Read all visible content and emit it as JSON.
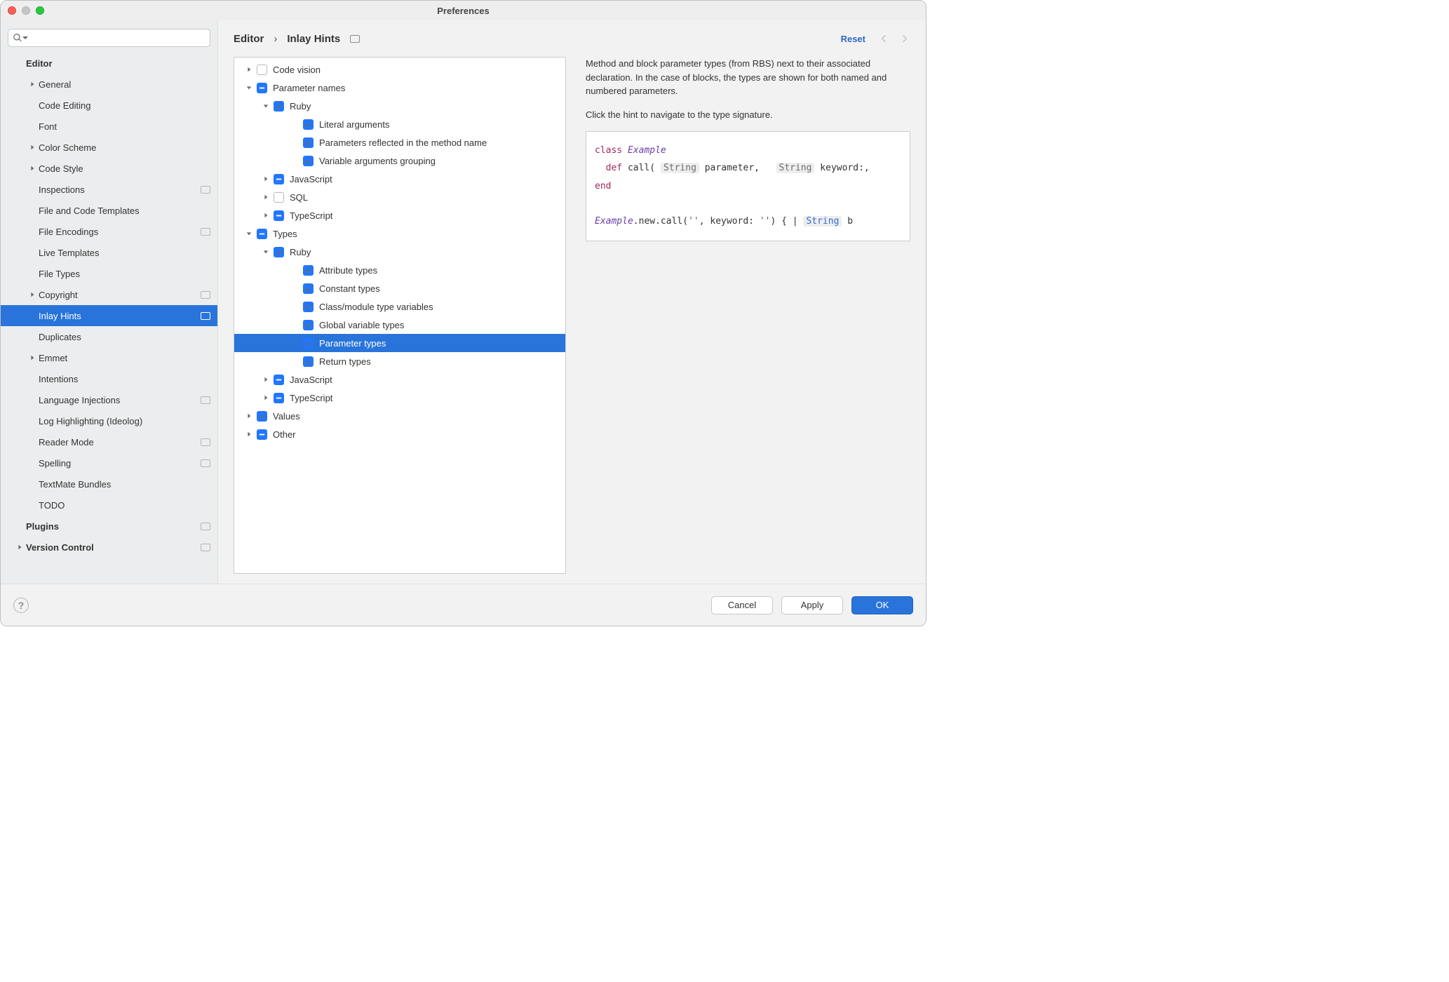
{
  "window_title": "Preferences",
  "search_placeholder": "",
  "sidebar": [
    {
      "label": "Editor",
      "header": true,
      "indent": 0,
      "chev": "",
      "badge": false
    },
    {
      "label": "General",
      "indent": 1,
      "chev": "right",
      "badge": false
    },
    {
      "label": "Code Editing",
      "indent": 1,
      "chev": "",
      "badge": false
    },
    {
      "label": "Font",
      "indent": 1,
      "chev": "",
      "badge": false
    },
    {
      "label": "Color Scheme",
      "indent": 1,
      "chev": "right",
      "badge": false
    },
    {
      "label": "Code Style",
      "indent": 1,
      "chev": "right",
      "badge": false
    },
    {
      "label": "Inspections",
      "indent": 1,
      "chev": "",
      "badge": true
    },
    {
      "label": "File and Code Templates",
      "indent": 1,
      "chev": "",
      "badge": false
    },
    {
      "label": "File Encodings",
      "indent": 1,
      "chev": "",
      "badge": true
    },
    {
      "label": "Live Templates",
      "indent": 1,
      "chev": "",
      "badge": false
    },
    {
      "label": "File Types",
      "indent": 1,
      "chev": "",
      "badge": false
    },
    {
      "label": "Copyright",
      "indent": 1,
      "chev": "right",
      "badge": true
    },
    {
      "label": "Inlay Hints",
      "indent": 1,
      "chev": "",
      "badge": true,
      "selected": true
    },
    {
      "label": "Duplicates",
      "indent": 1,
      "chev": "",
      "badge": false
    },
    {
      "label": "Emmet",
      "indent": 1,
      "chev": "right",
      "badge": false
    },
    {
      "label": "Intentions",
      "indent": 1,
      "chev": "",
      "badge": false
    },
    {
      "label": "Language Injections",
      "indent": 1,
      "chev": "",
      "badge": true
    },
    {
      "label": "Log Highlighting (Ideolog)",
      "indent": 1,
      "chev": "",
      "badge": false
    },
    {
      "label": "Reader Mode",
      "indent": 1,
      "chev": "",
      "badge": true
    },
    {
      "label": "Spelling",
      "indent": 1,
      "chev": "",
      "badge": true
    },
    {
      "label": "TextMate Bundles",
      "indent": 1,
      "chev": "",
      "badge": false
    },
    {
      "label": "TODO",
      "indent": 1,
      "chev": "",
      "badge": false
    },
    {
      "label": "Plugins",
      "header": true,
      "indent": 0,
      "chev": "",
      "badge": true
    },
    {
      "label": "Version Control",
      "header": true,
      "indent": 0,
      "chev": "right",
      "badge": true
    }
  ],
  "breadcrumb": {
    "root": "Editor",
    "current": "Inlay Hints",
    "reset": "Reset"
  },
  "hints_tree": [
    {
      "pad": 10,
      "chev": "right",
      "cb": "unchecked",
      "label": "Code vision"
    },
    {
      "pad": 10,
      "chev": "down",
      "cb": "indet",
      "label": "Parameter names"
    },
    {
      "pad": 34,
      "chev": "down",
      "cb": "checked",
      "label": "Ruby"
    },
    {
      "pad": 76,
      "chev": "",
      "cb": "checked",
      "label": "Literal arguments"
    },
    {
      "pad": 76,
      "chev": "",
      "cb": "checked",
      "label": "Parameters reflected in the method name"
    },
    {
      "pad": 76,
      "chev": "",
      "cb": "checked",
      "label": "Variable arguments grouping"
    },
    {
      "pad": 34,
      "chev": "right",
      "cb": "indet",
      "label": "JavaScript"
    },
    {
      "pad": 34,
      "chev": "right",
      "cb": "unchecked",
      "label": "SQL"
    },
    {
      "pad": 34,
      "chev": "right",
      "cb": "indet",
      "label": "TypeScript"
    },
    {
      "pad": 10,
      "chev": "down",
      "cb": "indet",
      "label": "Types"
    },
    {
      "pad": 34,
      "chev": "down",
      "cb": "checked",
      "label": "Ruby"
    },
    {
      "pad": 76,
      "chev": "",
      "cb": "checked",
      "label": "Attribute types"
    },
    {
      "pad": 76,
      "chev": "",
      "cb": "checked",
      "label": "Constant types"
    },
    {
      "pad": 76,
      "chev": "",
      "cb": "checked",
      "label": "Class/module type variables"
    },
    {
      "pad": 76,
      "chev": "",
      "cb": "checked",
      "label": "Global variable types"
    },
    {
      "pad": 76,
      "chev": "",
      "cb": "checked",
      "label": "Parameter types",
      "selected": true
    },
    {
      "pad": 76,
      "chev": "",
      "cb": "checked",
      "label": "Return types"
    },
    {
      "pad": 34,
      "chev": "right",
      "cb": "indet",
      "label": "JavaScript"
    },
    {
      "pad": 34,
      "chev": "right",
      "cb": "indet",
      "label": "TypeScript"
    },
    {
      "pad": 10,
      "chev": "right",
      "cb": "checked",
      "label": "Values"
    },
    {
      "pad": 10,
      "chev": "right",
      "cb": "indet",
      "label": "Other"
    }
  ],
  "description": {
    "p1": "Method and block parameter types (from RBS) next to their associated declaration. In the case of blocks, the types are shown for both named and numbered parameters.",
    "p2": "Click the hint to navigate to the type signature."
  },
  "code": {
    "kw_class": "class",
    "cls": "Example",
    "kw_def": "def",
    "method": "call",
    "hint_string": "String",
    "param": "parameter,",
    "keyword_label": "keyword:,",
    "kw_end": "end",
    "call_expr": "Example",
    "call_rest": ".new.call(",
    "str": "''",
    "sep": ", keyword: ",
    "str2": "''",
    "close": ") { | ",
    "hint_string2": "String",
    "tail": " b"
  },
  "footer": {
    "cancel": "Cancel",
    "apply": "Apply",
    "ok": "OK"
  }
}
